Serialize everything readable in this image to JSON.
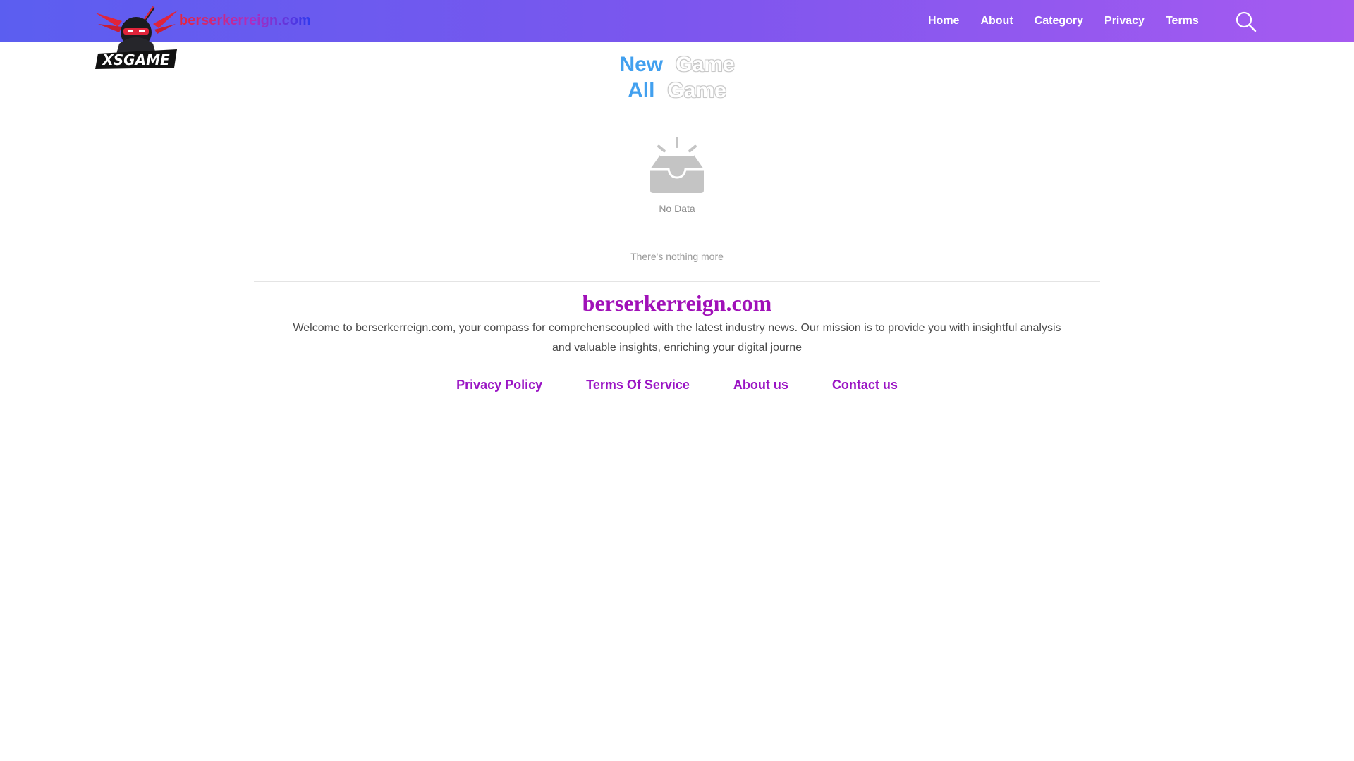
{
  "header": {
    "logo_icon": "ninja-game-logo",
    "logo_text": "XSGAME",
    "brand": "berserkerreign.com",
    "nav": [
      "Home",
      "About",
      "Category",
      "Privacy",
      "Terms"
    ],
    "search_icon": "search-icon",
    "gradient_colors": [
      "#5b5ef0",
      "#a65af0"
    ]
  },
  "sections": {
    "new_title_accent": "New",
    "new_title_rest": "Game",
    "all_title_accent": "All",
    "all_title_rest": "Game"
  },
  "empty_state": {
    "icon": "empty-inbox-icon",
    "text": "No Data"
  },
  "nothing_more": "There's nothing more",
  "footer": {
    "brand": "berserkerreign.com",
    "description": "Welcome to berserkerreign.com, your compass for comprehenscoupled with the latest industry news. Our mission is to provide you with insightful analysis and valuable insights, enriching your digital journe",
    "links": [
      "Privacy Policy",
      "Terms Of Service",
      "About us",
      "Contact us"
    ],
    "brand_color": "#a010b8"
  }
}
